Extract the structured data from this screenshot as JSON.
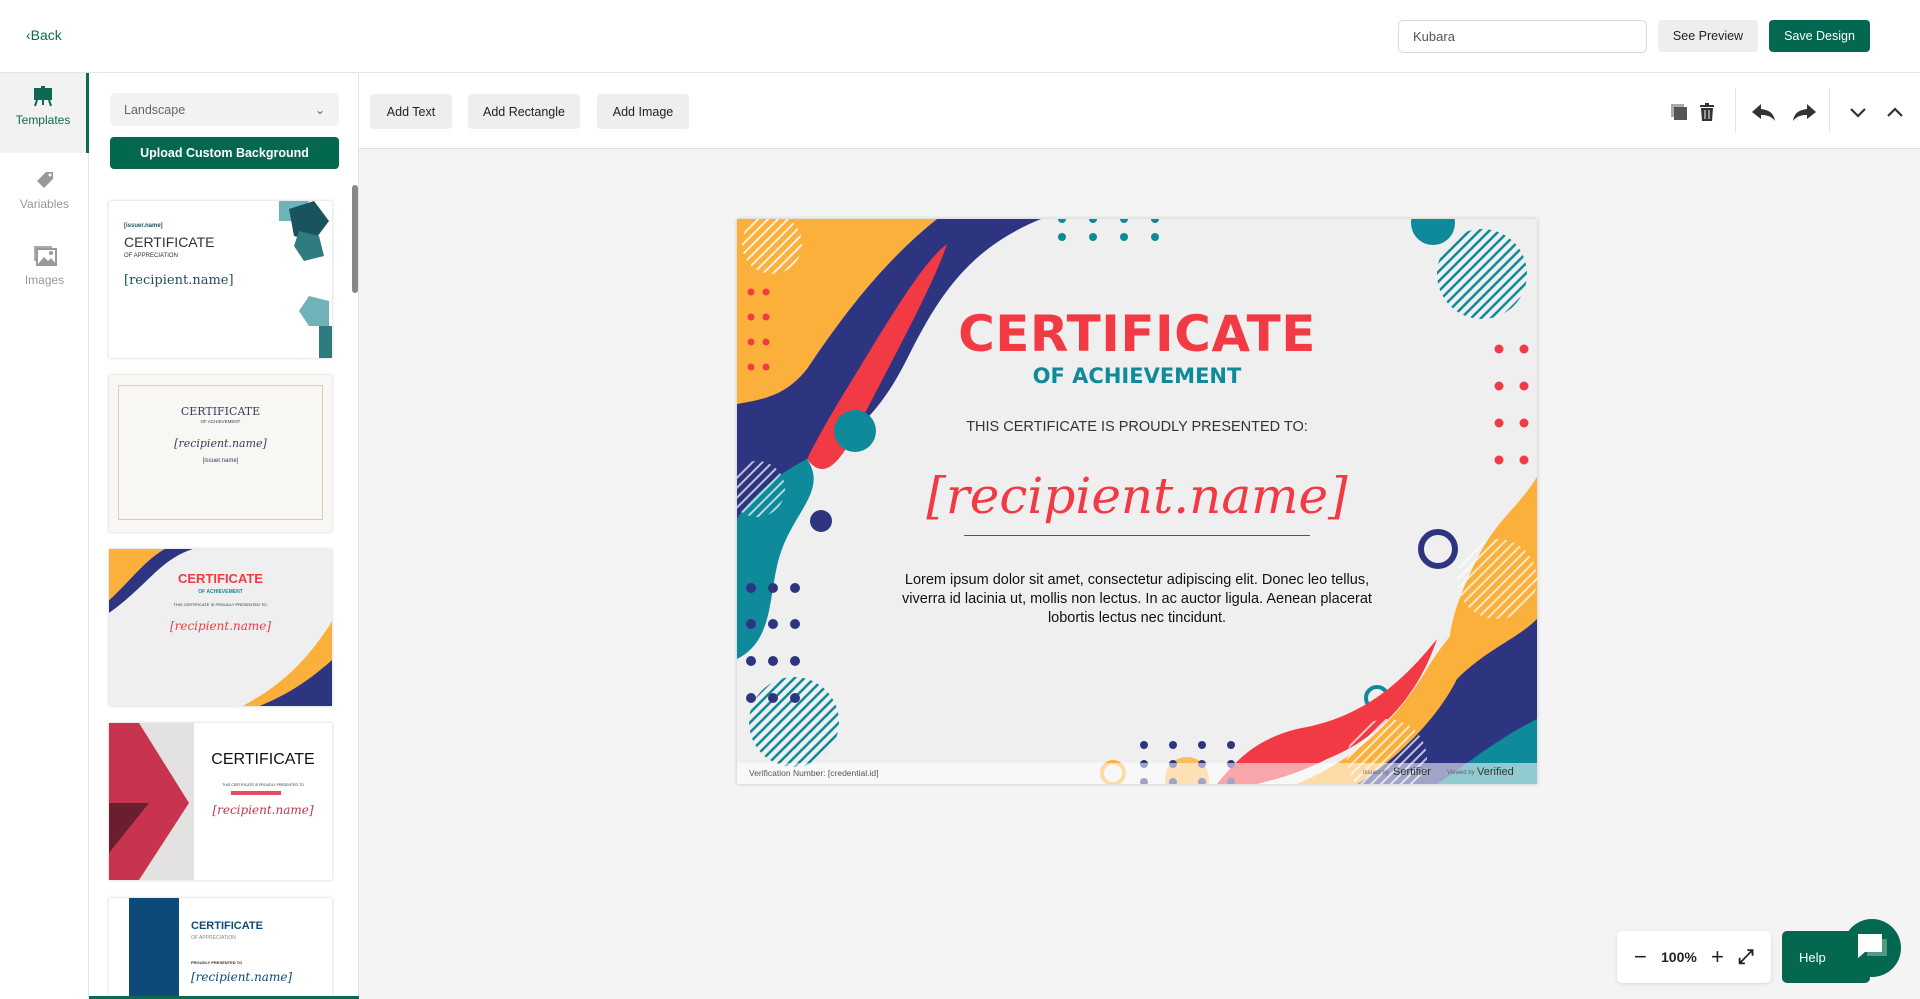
{
  "header": {
    "back_label": "Back",
    "name_value": "Kubara",
    "preview_label": "See Preview",
    "save_label": "Save Design"
  },
  "rail": {
    "items": [
      {
        "label": "Templates",
        "icon": "easel-icon"
      },
      {
        "label": "Variables",
        "icon": "tag-icon"
      },
      {
        "label": "Images",
        "icon": "images-icon"
      }
    ]
  },
  "panel": {
    "orientation": "Landscape",
    "upload_label": "Upload Custom Background",
    "templates": [
      {
        "issuer": "[issuer.name]",
        "title": "CERTIFICATE",
        "subtitle": "OF APPRECIATION",
        "name": "[recipient.name]"
      },
      {
        "title": "CERTIFICATE",
        "subtitle": "OF ACHIEVEMENT",
        "name": "[recipient.name]",
        "issuer": "[issuer.name]"
      },
      {
        "title": "CERTIFICATE",
        "subtitle": "OF ACHIEVEMENT",
        "presented": "THIS CERTIFICATE IS PROUDLY PRESENTED TO:",
        "name": "[recipient.name]"
      },
      {
        "title": "CERTIFICATE",
        "presented": "THIS CERTIFICATE IS PROUDLY PRESENTED TO",
        "name": "[recipient.name]"
      },
      {
        "title": "CERTIFICATE",
        "subtitle": "OF APPRECIATION",
        "presented": "PROUDLY PRESENTED TO",
        "name": "[recipient.name]"
      }
    ]
  },
  "toolbar": {
    "add_text": "Add Text",
    "add_rectangle": "Add Rectangle",
    "add_image": "Add Image"
  },
  "certificate": {
    "title": "CERTIFICATE",
    "subtitle": "OF ACHIEVEMENT",
    "presented": "THIS CERTIFICATE IS PROUDLY PRESENTED TO:",
    "recipient": "[recipient.name]",
    "body": "Lorem ipsum dolor sit amet, consectetur adipiscing elit. Donec leo tellus, viverra id lacinia ut, mollis non lectus. In ac auctor ligula. Aenean placerat lobortis lectus nec tincidunt.",
    "verification": "Verification Number: [credential.id]",
    "issued_by": "Issued by",
    "issuer_logo": "Sertifier",
    "viewed_by": "Viewed by",
    "viewer_logo": "Verified",
    "colors": {
      "red": "#f23a45",
      "teal": "#0e8a9a",
      "navy": "#2e3580",
      "yellow": "#fbb03b"
    }
  },
  "zoom": {
    "level": "100%"
  },
  "help": {
    "label": "Help"
  },
  "brand_color": "#03684f"
}
